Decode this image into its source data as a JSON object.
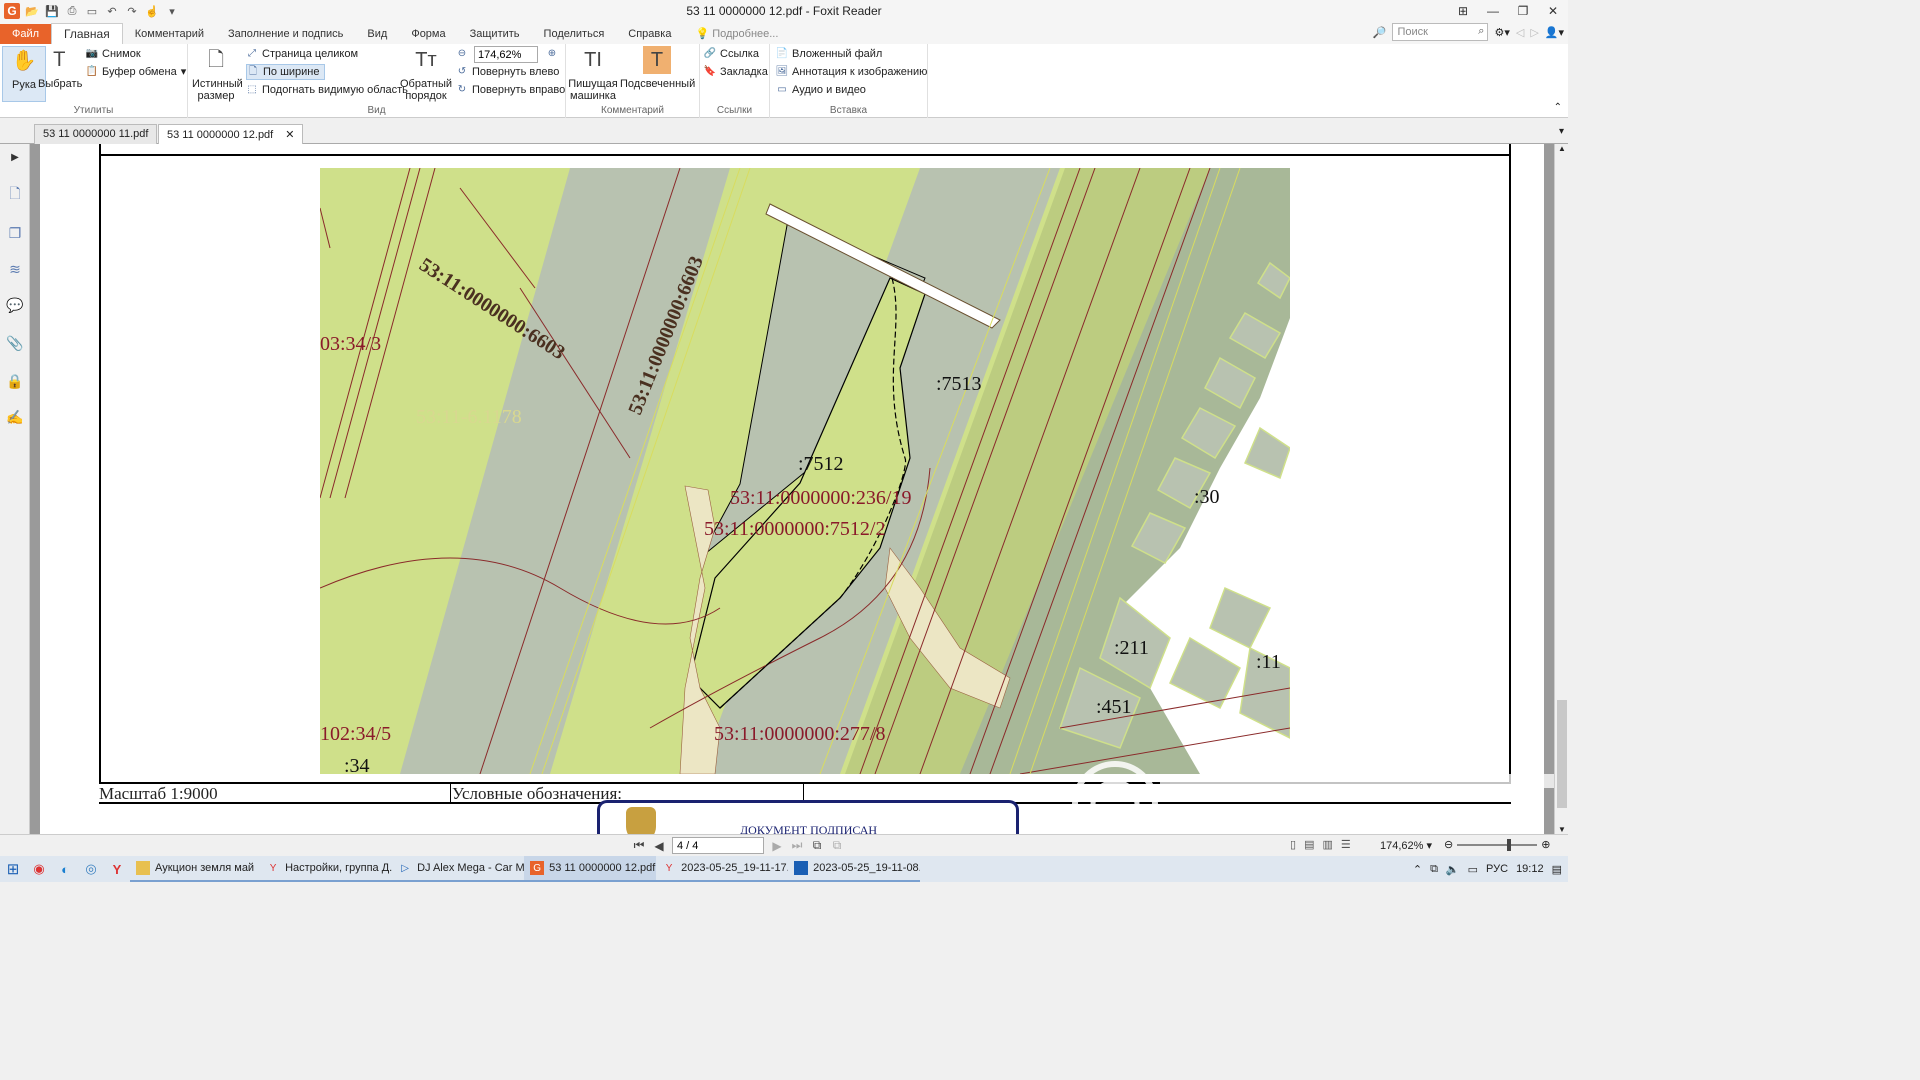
{
  "window": {
    "title": "53 11 0000000 12.pdf - Foxit Reader"
  },
  "menu": {
    "file": "Файл",
    "tabs": [
      "Главная",
      "Комментарий",
      "Заполнение и подпись",
      "Вид",
      "Форма",
      "Защитить",
      "Поделиться",
      "Справка"
    ],
    "tell_me": "Подробнее...",
    "search_placeholder": "Поиск"
  },
  "ribbon": {
    "hand": "Рука",
    "select": "Выбрать",
    "snapshot": "Снимок",
    "clipboard": "Буфер обмена",
    "utilities_label": "Утилиты",
    "actual_size": "Истинный размер",
    "fit_page": "Страница целиком",
    "fit_width": "По ширине",
    "fit_visible": "Подогнать видимую область",
    "reflow": "Обратный порядок",
    "zoom_value": "174,62%",
    "rotate_left": "Повернуть влево",
    "rotate_right": "Повернуть вправо",
    "view_label": "Вид",
    "typewriter": "Пишущая машинка",
    "highlight": "Подсвеченный",
    "comment_label": "Комментарий",
    "link": "Ссылка",
    "bookmark": "Закладка",
    "links_label": "Ссылки",
    "attachment": "Вложенный файл",
    "image_annotation": "Аннотация к изображению",
    "audio_video": "Аудио и видео",
    "insert_label": "Вставка"
  },
  "doc_tabs": [
    "53 11 0000000 11.pdf",
    "53 11 0000000 12.pdf"
  ],
  "map": {
    "labels": {
      "l6603a": "53:11:0000000:6603",
      "l6603b": "53:11:0000000:6603",
      "l343": "03:34/3",
      "l1178": "53:11-6.1178",
      "l7513": ":7513",
      "l7512": ":7512",
      "l236": "53:11:0000000:236/19",
      "l75122": "53:11:0000000:7512/2",
      "l30": ":30",
      "l211": ":211",
      "l11": ":11",
      "l451": ":451",
      "l345": "102:34/5",
      "l34": ":34",
      "l2778": "53:11:0000000:277/8"
    }
  },
  "doc": {
    "scale": "Масштаб 1:9000",
    "legend": "Условные обозначения:",
    "signed": "ДОКУМЕНТ ПОДПИСАН"
  },
  "statusbar": {
    "page": "4 / 4",
    "zoom": "174,62%"
  },
  "taskbar": {
    "items": [
      "Аукцион земля май",
      "Настройки, группа Д...",
      "DJ Alex Mega - Car M...",
      "53 11 0000000 12.pdf ...",
      "2023-05-25_19-11-17....",
      "2023-05-25_19-11-08...."
    ],
    "lang": "РУС",
    "time": "19:12"
  },
  "colors": {
    "accent": "#e8632a",
    "map_green": "#cfe08a",
    "map_gray": "#b8c2b0",
    "label_red": "#8a1a2a"
  }
}
